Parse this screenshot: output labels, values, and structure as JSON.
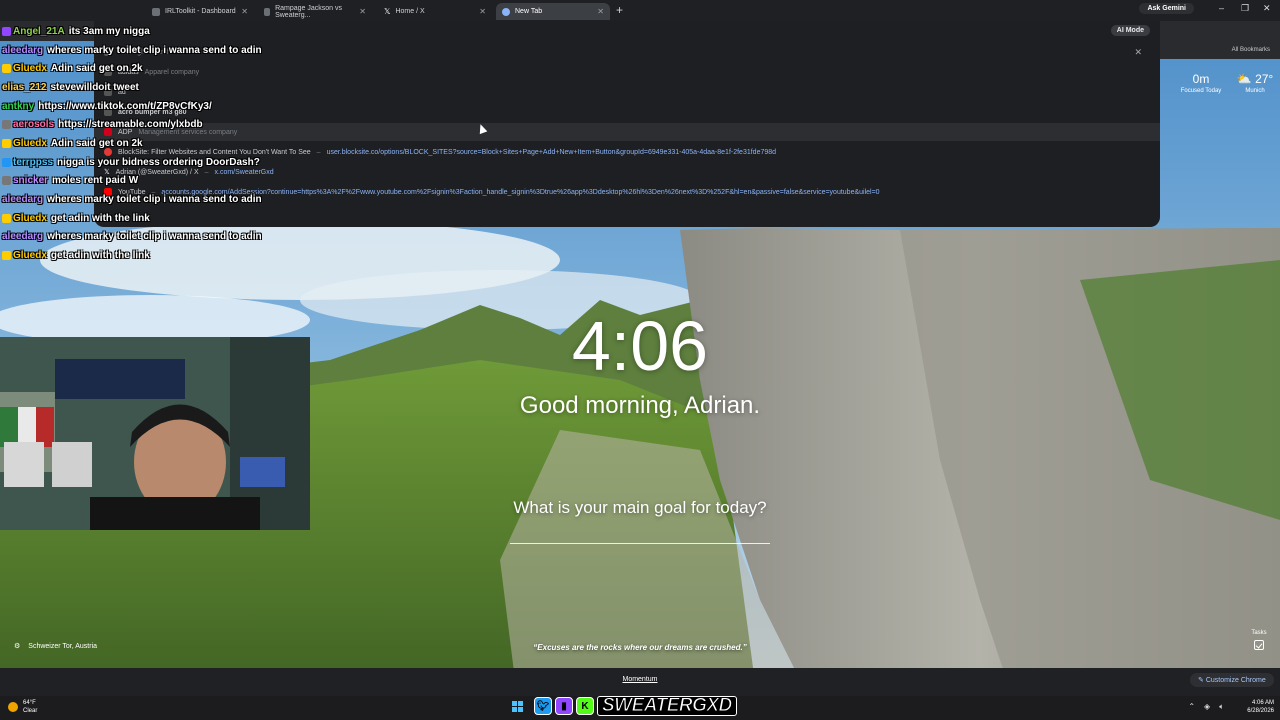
{
  "browser": {
    "tabs": [
      {
        "label": "IRLToolkit - Dashboard",
        "active": false
      },
      {
        "label": "Rampage Jackson vs Sweaterg...",
        "active": false
      },
      {
        "label": "Home / X",
        "active": false
      },
      {
        "label": "New Tab",
        "active": true
      }
    ],
    "new_tab_symbol": "+",
    "gemini_label": "Ask Gemini",
    "window_controls": [
      "–",
      "❐",
      "✕"
    ]
  },
  "omnibox": {
    "ai_mode_label": "AI Mode",
    "close_symbol": "✕",
    "suggestions": [
      {
        "title": "",
        "sub": "Google Search",
        "url": ""
      },
      {
        "title": "adidas",
        "sub": "Apparel company",
        "url": ""
      },
      {
        "title": "ad",
        "sub": "",
        "url": ""
      },
      {
        "title": "acro bumper m3 g80",
        "sub": "",
        "url": ""
      },
      {
        "title": "ADP",
        "sub": "Management services company",
        "url": ""
      },
      {
        "title": "BlockSite: Filter Websites and Content You Don't Want To See",
        "sub": "",
        "url": "user.blocksite.co/options/BLOCK_SITES?source=Block+Sites+Page+Add+New+Item+Button&groupId=6949e331-405a-4daa-8e1f-2fe31fde798d"
      },
      {
        "title": "Adrian (@SweaterGxd) / X",
        "sub": "",
        "url": "x.com/SweaterGxd"
      },
      {
        "title": "YouTube",
        "sub": "",
        "url": "accounts.google.com/AddSession?continue=https%3A%2F%2Fwww.youtube.com%2Fsignin%3Faction_handle_signin%3Dtrue%26app%3Ddesktop%26hl%3Den%26next%3D%252F&hl=en&passive=false&service=youtube&uilel=0"
      }
    ],
    "bookmarks_label": "All Bookmarks"
  },
  "chat": [
    {
      "user": "Angel_21A",
      "msg": "its 3am my nigga",
      "color": "#8fd14f",
      "badge": "#9146ff"
    },
    {
      "user": "aleedarg",
      "msg": "wheres marky toilet clip i wanna send to adin",
      "color": "#b58cff",
      "badge": ""
    },
    {
      "user": "Gluedx",
      "msg": "Adin said get on 2k",
      "color": "#ffcc00",
      "badge": "#ffcc00"
    },
    {
      "user": "elias_212",
      "msg": "stevewilldoit tweet",
      "color": "#ffd24a",
      "badge": ""
    },
    {
      "user": "antkny",
      "msg": "https://www.tiktok.com/t/ZP8vCfKy3/",
      "color": "#39d353",
      "badge": ""
    },
    {
      "user": "aerosols",
      "msg": "https://streamable.com/ylxbdb",
      "color": "#ff6ea1",
      "badge": "#777"
    },
    {
      "user": "Gluedx",
      "msg": "Adin said get on 2k",
      "color": "#ffcc00",
      "badge": "#ffcc00"
    },
    {
      "user": "terrppss",
      "msg": "nigga is your bidness ordering DoorDash?",
      "color": "#4fc3f7",
      "badge": "#2196f3"
    },
    {
      "user": "snicker",
      "msg": "moles rent paid W",
      "color": "#c38bff",
      "badge": "#777"
    },
    {
      "user": "aleedarg",
      "msg": "wheres marky toilet clip i wanna send to adin",
      "color": "#b58cff",
      "badge": ""
    },
    {
      "user": "Gluedx",
      "msg": "get adin with the link",
      "color": "#ffcc00",
      "badge": "#ffcc00"
    },
    {
      "user": "aleedarg",
      "msg": "wheres marky toilet clip i wanna send to adin",
      "color": "#b58cff",
      "badge": ""
    },
    {
      "user": "Gluedx",
      "msg": "get adin with the link",
      "color": "#ffcc00",
      "badge": "#ffcc00"
    }
  ],
  "momentum": {
    "focus_value": "0m",
    "focus_label": "Focused Today",
    "temperature": "27°",
    "weather_location": "Munich",
    "clock": "4:06",
    "greeting": "Good morning, Adrian.",
    "goal_question": "What is your main goal for today?",
    "photo_location": "Schweizer Tor, Austria",
    "quote": "“Excuses are the rocks where our dreams are crushed.”",
    "tasks_label": "Tasks",
    "footer_link": "Momentum",
    "customize_label": "Customize Chrome"
  },
  "taskbar": {
    "weather_temp": "64°F",
    "weather_desc": "Clear",
    "brand_name": "SWEATERGXD",
    "time": "4:06 AM",
    "date": "6/28/2026"
  }
}
